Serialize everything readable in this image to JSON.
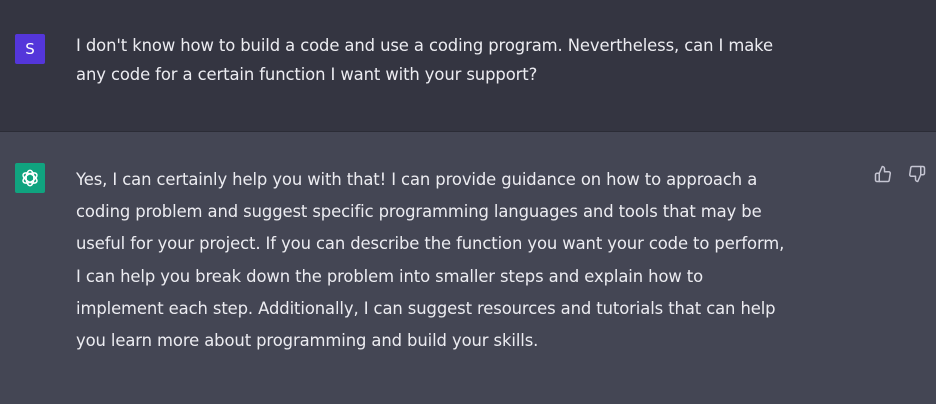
{
  "user_message": {
    "avatar_letter": "S",
    "text": "I don't know how to build a code and use a coding program. Nevertheless, can I make\nany code for a certain function I want with your support?"
  },
  "assistant_message": {
    "avatar_icon": "openai-logo-icon",
    "text": "Yes, I can certainly help you with that! I can provide guidance on how to approach a\ncoding problem and suggest specific programming languages and tools that may be\nuseful for your project. If you can describe the function you want your code to perform,\nI can help you break down the problem into smaller steps and explain how to\nimplement each step. Additionally, I can suggest resources and tutorials that can help\nyou learn more about programming and build your skills."
  },
  "feedback": {
    "like_icon": "thumbs-up-icon",
    "dislike_icon": "thumbs-down-icon"
  },
  "colors": {
    "user_bg": "#343541",
    "assistant_bg": "#444654",
    "user_avatar": "#5436da",
    "bot_avatar": "#10a37f",
    "text": "#ececf1"
  }
}
